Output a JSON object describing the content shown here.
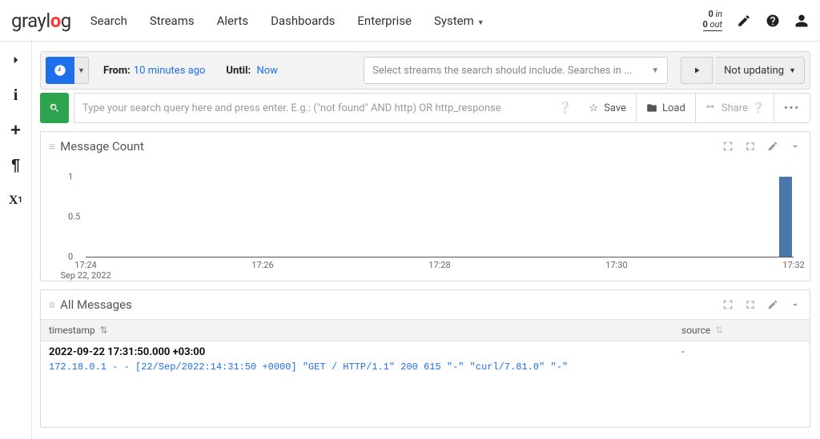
{
  "nav": {
    "items": [
      "Search",
      "Streams",
      "Alerts",
      "Dashboards",
      "Enterprise",
      "System"
    ],
    "in_count": "0",
    "in_label": "in",
    "out_count": "0",
    "out_label": "out"
  },
  "timerange": {
    "from_label": "From:",
    "from_value": "10 minutes ago",
    "until_label": "Until:",
    "until_value": "Now"
  },
  "streams_placeholder": "Select streams the search should include. Searches in ...",
  "refresh_label": "Not updating",
  "query_placeholder": "Type your search query here and press enter. E.g.: (\"not found\" AND http) OR http_response",
  "toolbar": {
    "save": "Save",
    "load": "Load",
    "share": "Share"
  },
  "panel_msgcount": {
    "title": "Message Count"
  },
  "panel_allmsg": {
    "title": "All Messages"
  },
  "columns": {
    "timestamp": "timestamp",
    "source": "source"
  },
  "rows": [
    {
      "ts": "2022-09-22 17:31:50.000 +03:00",
      "source": "-",
      "msg": "172.18.0.1 - - [22/Sep/2022:14:31:50 +0000] \"GET / HTTP/1.1\" 200 615 \"-\" \"curl/7.81.0\" \"-\""
    }
  ],
  "chart_data": {
    "type": "bar",
    "x": [
      "17:24",
      "17:26",
      "17:28",
      "17:30",
      "17:32"
    ],
    "xdate": "Sep 22, 2022",
    "yticks": [
      0,
      0.5,
      1
    ],
    "ylim": [
      0,
      1
    ],
    "series": [
      {
        "name": "Message Count",
        "values": [
          0,
          0,
          0,
          0,
          1
        ]
      }
    ],
    "title": "Message Count",
    "xlabel": "",
    "ylabel": ""
  }
}
